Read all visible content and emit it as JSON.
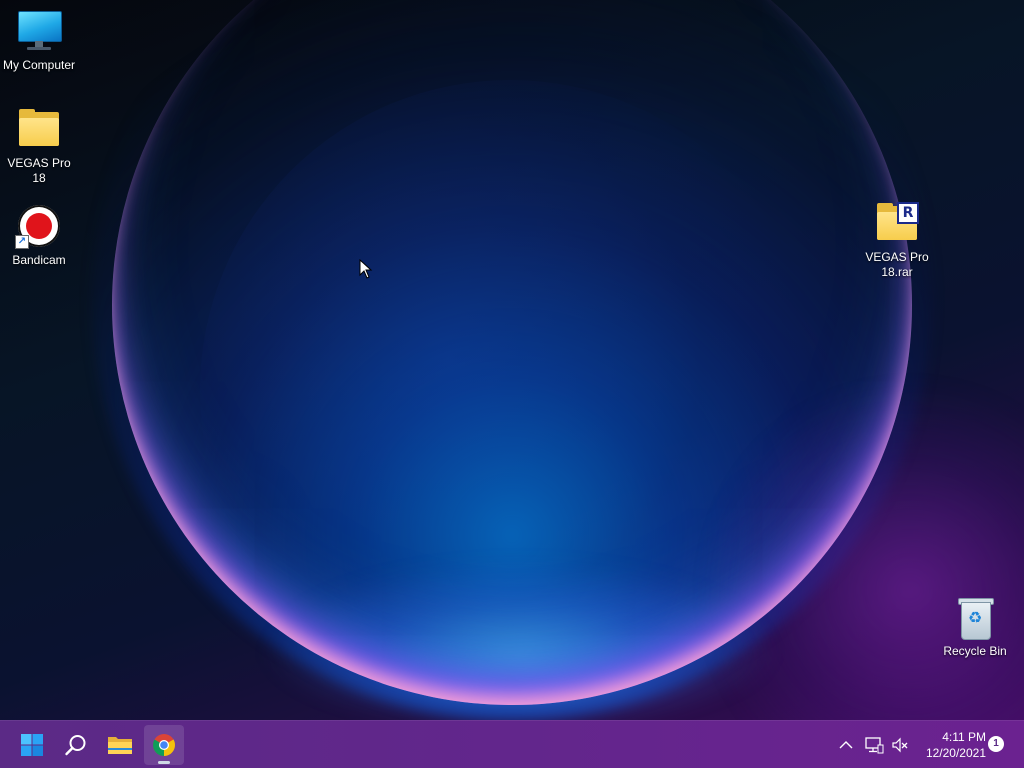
{
  "desktop": {
    "icons": [
      {
        "label": "My Computer",
        "icon": "monitor-icon"
      },
      {
        "label": "VEGAS Pro 18",
        "icon": "folder-icon"
      },
      {
        "label": "Bandicam",
        "icon": "record-icon"
      },
      {
        "label": "VEGAS Pro 18.rar",
        "icon": "rar-archive-icon",
        "badge": "R"
      },
      {
        "label": "Recycle Bin",
        "icon": "recycle-bin-icon"
      }
    ],
    "shortcut_glyph": "↗",
    "recycle_glyph": "♻"
  },
  "taskbar": {
    "pinned": [
      {
        "icon": "windows-start-icon"
      },
      {
        "icon": "search-icon"
      },
      {
        "icon": "file-explorer-icon"
      },
      {
        "icon": "chrome-icon",
        "active": true
      }
    ],
    "tray": {
      "chevron": "^",
      "time": "4:11 PM",
      "date": "12/20/2021",
      "notification_count": "1"
    }
  },
  "colors": {
    "taskbar": "#62268c",
    "accent_blue": "#1fa8e6",
    "folder": "#f7cd4c",
    "record_red": "#e0141b"
  }
}
